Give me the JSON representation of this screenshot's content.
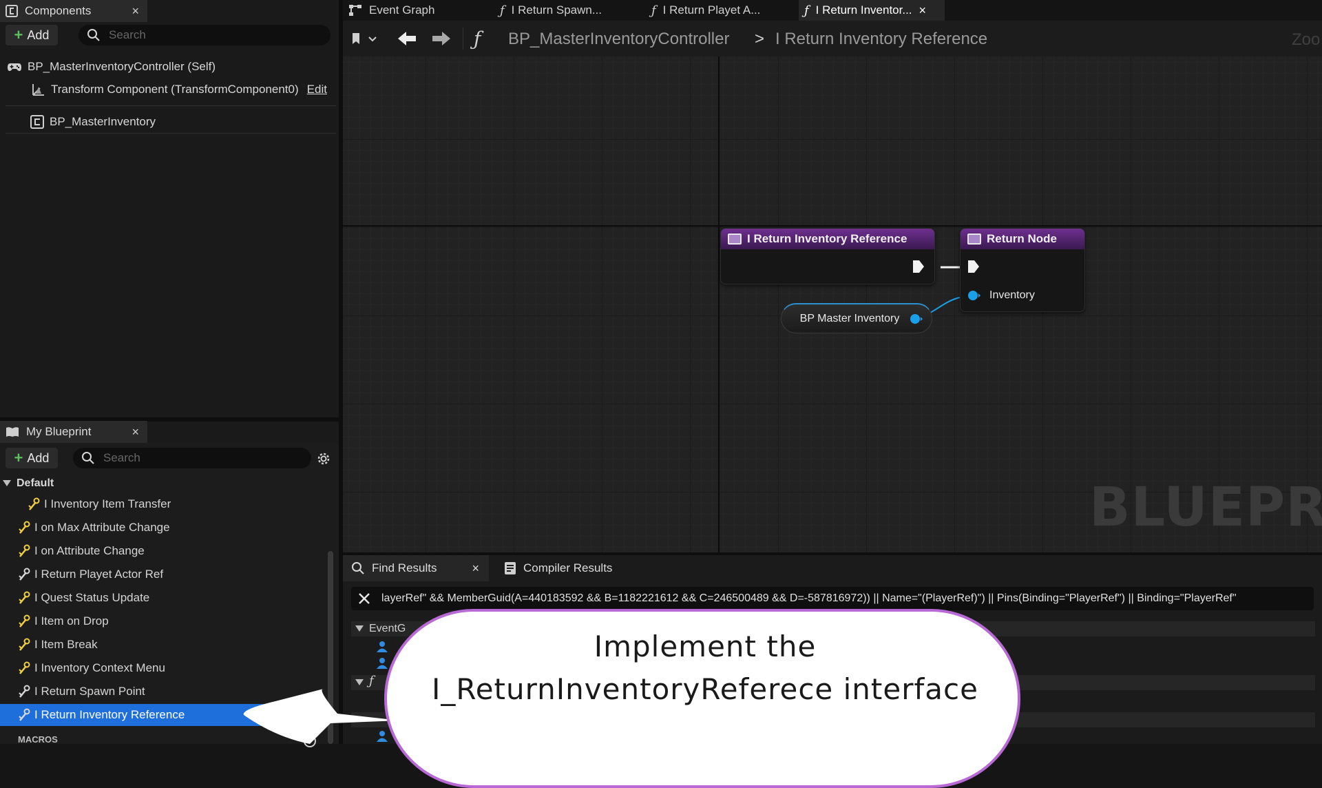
{
  "components_panel": {
    "tab_label": "Components",
    "close": "×",
    "add_label": "Add",
    "search_placeholder": "Search",
    "root": "BP_MasterInventoryController (Self)",
    "transform": "Transform Component (TransformComponent0)",
    "edit_label": "Edit",
    "child": "BP_MasterInventory"
  },
  "my_blueprint": {
    "tab_label": "My Blueprint",
    "close": "×",
    "add_label": "Add",
    "search_placeholder": "Search",
    "section_default": "Default",
    "items": [
      "I Inventory Item Transfer",
      "I on Max Attribute Change",
      "I on Attribute Change",
      "I Return Playet Actor Ref",
      "I Quest Status Update",
      "I Item on Drop",
      "I Item Break",
      "I Inventory Context Menu",
      "I Return Spawn Point",
      "I Return Inventory Reference"
    ],
    "section_macros": "MACROS"
  },
  "doc_tabs": [
    {
      "label": "Event Graph",
      "icon": "event-graph-icon"
    },
    {
      "label": "I Return Spawn...",
      "icon": "function-icon"
    },
    {
      "label": "I Return Playet A...",
      "icon": "function-icon"
    },
    {
      "label": "I Return Inventor...",
      "icon": "function-icon",
      "active": true
    }
  ],
  "toolbar": {
    "breadcrumb_root": "BP_MasterInventoryController",
    "breadcrumb_sep": ">",
    "breadcrumb_current": "I Return Inventory Reference",
    "zoom": "Zoo"
  },
  "graph": {
    "entry_node_title": "I Return Inventory Reference",
    "return_node_title": "Return Node",
    "return_pin_label": "Inventory",
    "get_node_label": "BP Master Inventory",
    "watermark": "BLUEPRIN"
  },
  "bottom_panel": {
    "find_tab": "Find Results",
    "compiler_tab": "Compiler Results",
    "close": "×",
    "filter_text": "layerRef\" && MemberGuid(A=440183592 && B=1182221612 && C=246500489 && D=-587816972)) || Name=\"(PlayerRef)\") || Pins(Binding=\"PlayerRef\") || Binding=\"PlayerRef\"",
    "result_event_label": "EventG",
    "result_g_label": "G"
  },
  "callout": {
    "line1": "Implement the",
    "line2": "I_ReturnInventoryReferece interface"
  },
  "colors": {
    "selection": "#1e6fdb",
    "node_header": "#6e2f8f",
    "pin_blue": "#1aa0e8",
    "callout_border": "#b869d6"
  }
}
